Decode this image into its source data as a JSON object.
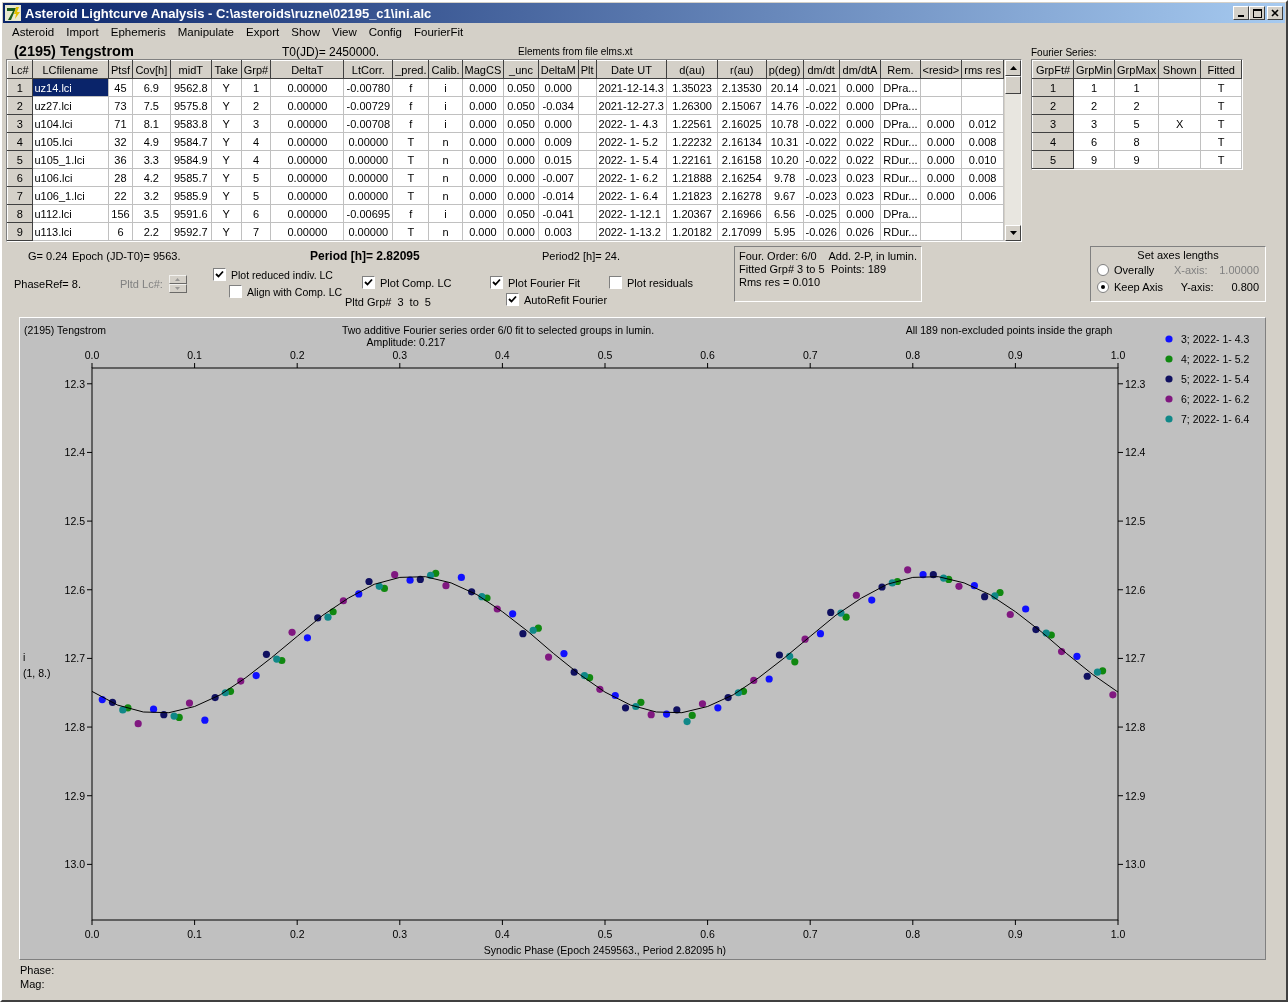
{
  "window": {
    "title": "Asteroid Lightcurve Analysis - C:\\asteroids\\ruzne\\02195_c1\\ini.alc"
  },
  "menu": [
    "Asteroid",
    "Import",
    "Ephemeris",
    "Manipulate",
    "Export",
    "Show",
    "View",
    "Config",
    "FourierFit"
  ],
  "asteroid": "(2195) Tengstrom",
  "t0": "T0(JD)= 2450000.",
  "elements_note": "Elements from file elms.xt",
  "lc_table": {
    "columns": [
      "Lc#",
      "LCfilename",
      "Ptsf",
      "Cov[h]",
      "midT",
      "Take",
      "Grp#",
      "DeltaT",
      "LtCorr.",
      "_pred.",
      "Calib.",
      "MagCS",
      "_unc",
      "DeltaM",
      "Plt",
      "Date UT",
      "d(au)",
      "r(au)",
      "p(deg)",
      "dm/dt",
      "dm/dtA",
      "Rem.",
      "<resid>",
      "rms res"
    ],
    "rows": [
      {
        "selected": true,
        "cells": [
          "1",
          "uz14.lci",
          "45",
          "6.9",
          "9562.8",
          "Y",
          "1",
          "0.00000",
          "-0.00780",
          "f",
          "i",
          "0.000",
          "0.050",
          "0.000",
          null,
          "2021-12-14.3",
          "1.35023",
          "2.13530",
          "20.14",
          "-0.021",
          "0.000",
          "DPra...",
          null,
          null
        ]
      },
      {
        "selected": false,
        "cells": [
          "2",
          "uz27.lci",
          "73",
          "7.5",
          "9575.8",
          "Y",
          "2",
          "0.00000",
          "-0.00729",
          "f",
          "i",
          "0.000",
          "0.050",
          "-0.034",
          null,
          "2021-12-27.3",
          "1.26300",
          "2.15067",
          "14.76",
          "-0.022",
          "0.000",
          "DPra...",
          null,
          null
        ]
      },
      {
        "selected": false,
        "cells": [
          "3",
          "u104.lci",
          "71",
          "8.1",
          "9583.8",
          "Y",
          "3",
          "0.00000",
          "-0.00708",
          "f",
          "i",
          "0.000",
          "0.050",
          "0.000",
          null,
          "2022- 1- 4.3",
          "1.22561",
          "2.16025",
          "10.78",
          "-0.022",
          "0.000",
          "DPra...",
          "0.000",
          "0.012"
        ]
      },
      {
        "selected": false,
        "cells": [
          "4",
          "u105.lci",
          "32",
          "4.9",
          "9584.7",
          "Y",
          "4",
          "0.00000",
          "0.00000",
          "T",
          "n",
          "0.000",
          "0.000",
          "0.009",
          null,
          "2022- 1- 5.2",
          "1.22232",
          "2.16134",
          "10.31",
          "-0.022",
          "0.022",
          "RDur...",
          "0.000",
          "0.008"
        ]
      },
      {
        "selected": false,
        "cells": [
          "5",
          "u105_1.lci",
          "36",
          "3.3",
          "9584.9",
          "Y",
          "4",
          "0.00000",
          "0.00000",
          "T",
          "n",
          "0.000",
          "0.000",
          "0.015",
          null,
          "2022- 1- 5.4",
          "1.22161",
          "2.16158",
          "10.20",
          "-0.022",
          "0.022",
          "RDur...",
          "0.000",
          "0.010"
        ]
      },
      {
        "selected": false,
        "cells": [
          "6",
          "u106.lci",
          "28",
          "4.2",
          "9585.7",
          "Y",
          "5",
          "0.00000",
          "0.00000",
          "T",
          "n",
          "0.000",
          "0.000",
          "-0.007",
          null,
          "2022- 1- 6.2",
          "1.21888",
          "2.16254",
          "9.78",
          "-0.023",
          "0.023",
          "RDur...",
          "0.000",
          "0.008"
        ]
      },
      {
        "selected": false,
        "cells": [
          "7",
          "u106_1.lci",
          "22",
          "3.2",
          "9585.9",
          "Y",
          "5",
          "0.00000",
          "0.00000",
          "T",
          "n",
          "0.000",
          "0.000",
          "-0.014",
          null,
          "2022- 1- 6.4",
          "1.21823",
          "2.16278",
          "9.67",
          "-0.023",
          "0.023",
          "RDur...",
          "0.000",
          "0.006"
        ]
      },
      {
        "selected": false,
        "cells": [
          "8",
          "u112.lci",
          "156",
          "3.5",
          "9591.6",
          "Y",
          "6",
          "0.00000",
          "-0.00695",
          "f",
          "i",
          "0.000",
          "0.050",
          "-0.041",
          null,
          "2022- 1-12.1",
          "1.20367",
          "2.16966",
          "6.56",
          "-0.025",
          "0.000",
          "DPra...",
          null,
          null
        ]
      },
      {
        "selected": false,
        "cells": [
          "9",
          "u113.lci",
          "6",
          "2.2",
          "9592.7",
          "Y",
          "7",
          "0.00000",
          "0.00000",
          "T",
          "n",
          "0.000",
          "0.000",
          "0.003",
          null,
          "2022- 1-13.2",
          "1.20182",
          "2.17099",
          "5.95",
          "-0.026",
          "0.026",
          "RDur...",
          null,
          null
        ]
      }
    ]
  },
  "fourier_series": {
    "label": "Fourier Series:",
    "columns": [
      "GrpFt#",
      "GrpMin",
      "GrpMax",
      "Shown",
      "Fitted"
    ],
    "shown_symbol": "X",
    "rows": [
      {
        "grp_ft": "1",
        "grp_min": "1",
        "grp_max": "1",
        "shown": false,
        "fitted": "T"
      },
      {
        "grp_ft": "2",
        "grp_min": "2",
        "grp_max": "2",
        "shown": false,
        "fitted": "T"
      },
      {
        "grp_ft": "3",
        "grp_min": "3",
        "grp_max": "5",
        "shown": true,
        "fitted": "T"
      },
      {
        "grp_ft": "4",
        "grp_min": "6",
        "grp_max": "8",
        "shown": false,
        "fitted": "T"
      },
      {
        "grp_ft": "5",
        "grp_min": "9",
        "grp_max": "9",
        "shown": false,
        "fitted": "T"
      }
    ]
  },
  "g": "G= 0.24",
  "epoch": "Epoch (JD-T0)= 9563.",
  "period": "Period [h]= 2.82095",
  "period2": "Period2 [h]= 24.",
  "phase_ref": "PhaseRef= 8.",
  "pltd_lc": {
    "label": "Pltd Lc#:",
    "disabled": true
  },
  "checkboxes": [
    {
      "label": "Plot reduced indiv. LC",
      "checked": true
    },
    {
      "label": "Align with Comp. LC",
      "checked": false
    },
    {
      "label": "Plot Comp. LC",
      "checked": true
    },
    {
      "label": "Plot Fourier Fit",
      "checked": true
    },
    {
      "label": "AutoRefit Fourier",
      "checked": true
    },
    {
      "label": "Plot residuals",
      "checked": false
    }
  ],
  "pltd_grp": {
    "label": "Pltd Grp#",
    "from": "3",
    "to_label": "to",
    "to": "5"
  },
  "fit_info": [
    [
      "Four. Order:  6/0",
      "Add. 2-P, in lumin."
    ],
    [
      "Fitted Grp# 3 to 5",
      "Points: 189"
    ],
    [
      "Rms res     = 0.010"
    ]
  ],
  "axes": {
    "title": "Set axes lengths",
    "options": [
      {
        "label": "Overally",
        "selected": false,
        "axis_label": "X-axis:",
        "value": "1.00000",
        "disabled": true
      },
      {
        "label": "Keep Axis",
        "selected": true,
        "axis_label": "Y-axis:",
        "value": "0.800",
        "disabled": false
      }
    ]
  },
  "graph": {
    "object": "(2195) Tengstrom",
    "title": "Two additive Fourier series order 6/0 fit to selected groups in lumin.",
    "amplitude": "Amplitude: 0.217",
    "note": "All 189 non-excluded points inside the graph",
    "ylabel_note": "(1, 8.)",
    "right_axis_labels": [
      "12.3",
      "12.4",
      "12.5",
      "12.6",
      "12.7",
      "12.8",
      "12.9",
      "13.0"
    ],
    "chart_data": {
      "type": "scatter",
      "xlabel": "Synodic Phase (Epoch 2459563., Period 2.82095 h)",
      "ylabel": "i",
      "xlim": [
        0,
        1
      ],
      "ylim": [
        13.081,
        12.277
      ],
      "legend": "right",
      "xticks": [
        {
          "value": 0,
          "label": "0.0"
        },
        {
          "value": 0.1,
          "label": "0.1"
        },
        {
          "value": 0.2,
          "label": "0.2"
        },
        {
          "value": 0.3,
          "label": "0.3"
        },
        {
          "value": 0.4,
          "label": "0.4"
        },
        {
          "value": 0.5,
          "label": "0.5"
        },
        {
          "value": 0.6,
          "label": "0.6"
        },
        {
          "value": 0.7,
          "label": "0.7"
        },
        {
          "value": 0.8,
          "label": "0.8"
        },
        {
          "value": 0.9,
          "label": "0.9"
        },
        {
          "value": 1,
          "label": "1.0"
        }
      ],
      "yticks": [
        12.3,
        12.4,
        12.5,
        12.6,
        12.7,
        12.8,
        12.9,
        {
          "value": 13,
          "label": "13.0"
        }
      ],
      "series": [
        {
          "name": "3; 2022- 1- 4.3",
          "color": "#1010ff",
          "x": [
            0.01,
            0.06,
            0.11,
            0.16,
            0.21,
            0.26,
            0.31,
            0.36,
            0.41,
            0.46,
            0.51,
            0.56,
            0.61,
            0.66,
            0.71,
            0.76,
            0.81,
            0.86,
            0.91,
            0.96
          ],
          "values": [
            12.76,
            12.774,
            12.79,
            12.725,
            12.67,
            12.606,
            12.586,
            12.582,
            12.635,
            12.693,
            12.754,
            12.781,
            12.772,
            12.73,
            12.664,
            12.615,
            12.578,
            12.594,
            12.628,
            12.697
          ]
        },
        {
          "name": "4; 2022- 1- 5.2",
          "color": "#108810",
          "x": [
            0.035,
            0.085,
            0.135,
            0.185,
            0.235,
            0.285,
            0.335,
            0.385,
            0.435,
            0.485,
            0.535,
            0.585,
            0.635,
            0.685,
            0.735,
            0.785,
            0.835,
            0.885,
            0.935,
            0.985
          ],
          "values": [
            12.772,
            12.786,
            12.748,
            12.703,
            12.632,
            12.598,
            12.576,
            12.612,
            12.656,
            12.728,
            12.764,
            12.783,
            12.748,
            12.705,
            12.64,
            12.588,
            12.585,
            12.604,
            12.666,
            12.718
          ]
        },
        {
          "name": "5; 2022- 1- 5.4",
          "color": "#101060",
          "x": [
            0.02,
            0.07,
            0.12,
            0.17,
            0.22,
            0.27,
            0.32,
            0.37,
            0.42,
            0.47,
            0.52,
            0.57,
            0.62,
            0.67,
            0.72,
            0.77,
            0.82,
            0.87,
            0.92,
            0.97
          ],
          "values": [
            12.764,
            12.782,
            12.757,
            12.694,
            12.641,
            12.588,
            12.585,
            12.603,
            12.664,
            12.72,
            12.772,
            12.775,
            12.757,
            12.695,
            12.633,
            12.596,
            12.578,
            12.61,
            12.658,
            12.726
          ]
        },
        {
          "name": "6; 2022- 1- 6.2",
          "color": "#801880",
          "x": [
            0.045,
            0.095,
            0.145,
            0.195,
            0.245,
            0.295,
            0.345,
            0.395,
            0.445,
            0.495,
            0.545,
            0.595,
            0.645,
            0.695,
            0.745,
            0.795,
            0.845,
            0.895,
            0.945,
            0.995
          ],
          "values": [
            12.795,
            12.765,
            12.733,
            12.662,
            12.616,
            12.578,
            12.594,
            12.628,
            12.698,
            12.745,
            12.782,
            12.766,
            12.732,
            12.672,
            12.608,
            12.571,
            12.595,
            12.636,
            12.69,
            12.753
          ]
        },
        {
          "name": "7; 2022- 1- 6.4",
          "color": "#108888",
          "x": [
            0.03,
            0.08,
            0.13,
            0.18,
            0.23,
            0.28,
            0.33,
            0.38,
            0.43,
            0.48,
            0.53,
            0.58,
            0.63,
            0.68,
            0.73,
            0.78,
            0.83,
            0.88,
            0.93,
            0.98
          ],
          "values": [
            12.775,
            12.784,
            12.75,
            12.701,
            12.64,
            12.595,
            12.579,
            12.61,
            12.659,
            12.725,
            12.77,
            12.792,
            12.75,
            12.697,
            12.634,
            12.59,
            12.583,
            12.609,
            12.663,
            12.72
          ]
        },
        {
          "type": "line",
          "color": "#000000",
          "x": [
            0,
            0.025,
            0.05,
            0.075,
            0.1,
            0.125,
            0.15,
            0.175,
            0.2,
            0.225,
            0.25,
            0.275,
            0.3,
            0.325,
            0.35,
            0.375,
            0.4,
            0.425,
            0.45,
            0.475,
            0.5,
            0.525,
            0.55,
            0.575,
            0.6,
            0.625,
            0.65,
            0.675,
            0.7,
            0.725,
            0.75,
            0.775,
            0.8,
            0.825,
            0.85,
            0.875,
            0.9,
            0.925,
            0.95,
            0.975,
            1
          ],
          "values": [
            12.748,
            12.768,
            12.778,
            12.779,
            12.77,
            12.753,
            12.728,
            12.699,
            12.668,
            12.637,
            12.612,
            12.592,
            12.582,
            12.581,
            12.59,
            12.607,
            12.632,
            12.661,
            12.693,
            12.723,
            12.749,
            12.768,
            12.778,
            12.779,
            12.77,
            12.753,
            12.728,
            12.699,
            12.668,
            12.637,
            12.612,
            12.592,
            12.582,
            12.581,
            12.59,
            12.607,
            12.632,
            12.661,
            12.693,
            12.723,
            12.749
          ]
        }
      ]
    }
  },
  "footer": [
    "Phase:",
    "Mag:"
  ]
}
